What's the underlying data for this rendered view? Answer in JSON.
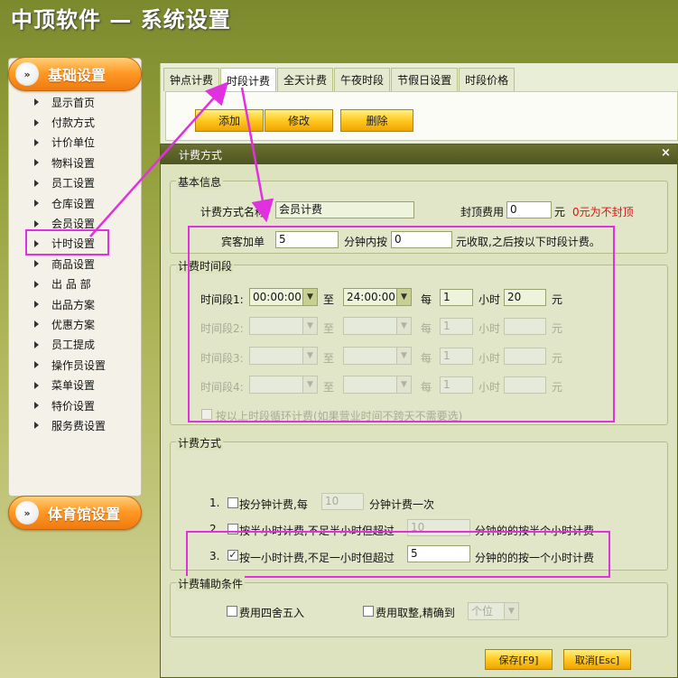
{
  "app": {
    "title": "中顶软件 — 系统设置"
  },
  "sidebar": {
    "basic_header": "基础设置",
    "gym_header": "体育馆设置",
    "items": [
      {
        "label": "显示首页"
      },
      {
        "label": "付款方式"
      },
      {
        "label": "计价单位"
      },
      {
        "label": "物料设置"
      },
      {
        "label": "员工设置"
      },
      {
        "label": "仓库设置"
      },
      {
        "label": "会员设置"
      },
      {
        "label": "计时设置"
      },
      {
        "label": "商品设置"
      },
      {
        "label": "出 品 部"
      },
      {
        "label": "出品方案"
      },
      {
        "label": "优惠方案"
      },
      {
        "label": "员工提成"
      },
      {
        "label": "操作员设置"
      },
      {
        "label": "菜单设置"
      },
      {
        "label": "特价设置"
      },
      {
        "label": "服务费设置"
      }
    ]
  },
  "tabs": [
    {
      "label": "钟点计费"
    },
    {
      "label": "时段计费"
    },
    {
      "label": "全天计费"
    },
    {
      "label": "午夜时段"
    },
    {
      "label": "节假日设置"
    },
    {
      "label": "时段价格"
    }
  ],
  "toolbar": {
    "add": "添加",
    "edit": "修改",
    "delete": "删除"
  },
  "dialog": {
    "title": "计费方式",
    "close": "×",
    "basic": {
      "legend": "基本信息",
      "name_label": "计费方式名称",
      "name_value": "会员计费",
      "cap_label": "封顶费用",
      "cap_value": "0",
      "cap_unit": "元",
      "cap_note": "0元为不封顶",
      "guest_label": "宾客加单",
      "guest_value": "5",
      "within_label": "分钟内按",
      "within_value": "0",
      "after_label": "元收取,之后按以下时段计费。"
    },
    "periods": {
      "legend": "计费时间段",
      "rows": [
        {
          "label": "时间段1:",
          "start": "00:00:00",
          "to": "至",
          "end": "24:00:00",
          "every": "每",
          "hours": "1",
          "hour_unit": "小时",
          "price": "20",
          "yuan": "元"
        },
        {
          "label": "时间段2:",
          "start": "",
          "to": "至",
          "end": "",
          "every": "每",
          "hours": "1",
          "hour_unit": "小时",
          "price": "",
          "yuan": "元"
        },
        {
          "label": "时间段3:",
          "start": "",
          "to": "至",
          "end": "",
          "every": "每",
          "hours": "1",
          "hour_unit": "小时",
          "price": "",
          "yuan": "元"
        },
        {
          "label": "时间段4:",
          "start": "",
          "to": "至",
          "end": "",
          "every": "每",
          "hours": "1",
          "hour_unit": "小时",
          "price": "",
          "yuan": "元"
        }
      ],
      "loop_label": "按以上时段循环计费(如果营业时间不跨天不需要选)"
    },
    "method": {
      "legend": "计费方式",
      "opt1_num": "1.",
      "opt1_a": "按分钟计费,每",
      "opt1_value": "10",
      "opt1_b": "分钟计费一次",
      "opt2_num": "2.",
      "opt2_a": "按半小时计费,不足半小时但超过",
      "opt2_value": "10",
      "opt2_b": "分钟的的按半个小时计费",
      "opt3_num": "3.",
      "opt3_a": "按一小时计费,不足一小时但超过",
      "opt3_value": "5",
      "opt3_b": "分钟的的按一个小时计费",
      "opt3_check": "✓"
    },
    "aux": {
      "legend": "计费辅助条件",
      "round_label": "费用四舍五入",
      "int_label": "费用取整,精确到",
      "int_value": "个位"
    },
    "save": "保存[F9]",
    "cancel": "取消[Esc]"
  },
  "colors": {
    "highlight": "#e030e0",
    "accent_orange": "#ff9a26",
    "warning_red": "#e01010"
  }
}
